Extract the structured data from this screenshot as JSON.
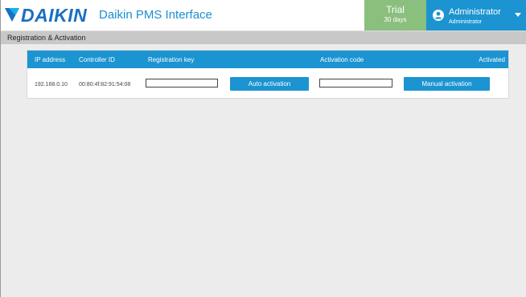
{
  "header": {
    "brand": "DAIKIN",
    "app_title": "Daikin PMS Interface",
    "trial": {
      "title": "Trial",
      "days": "30 days",
      "color": "#8bbf7d"
    },
    "user": {
      "name": "Administrator",
      "role": "Administrator",
      "color": "#1b94d1"
    }
  },
  "section": {
    "title": "Registration & Activation"
  },
  "table": {
    "columns": {
      "ip": "IP address",
      "controller": "Controller ID",
      "reg_key": "Registration key",
      "act_code": "Activation code",
      "activated": "Activated"
    },
    "rows": [
      {
        "ip": "192.168.0.10",
        "controller": "00:80:4f:82:91:54:08",
        "reg_key": "",
        "auto_btn": "Auto activation",
        "act_code": "",
        "manual_btn": "Manual activation"
      }
    ]
  },
  "icons": {
    "logo": "daikin-logo-icon",
    "avatar": "user-avatar-icon",
    "dropdown": "chevron-down-icon"
  },
  "colors": {
    "brand_blue": "#1a6fc1",
    "accent": "#1b94d1",
    "background": "#ececec",
    "section_bar": "#c8c8c8"
  }
}
